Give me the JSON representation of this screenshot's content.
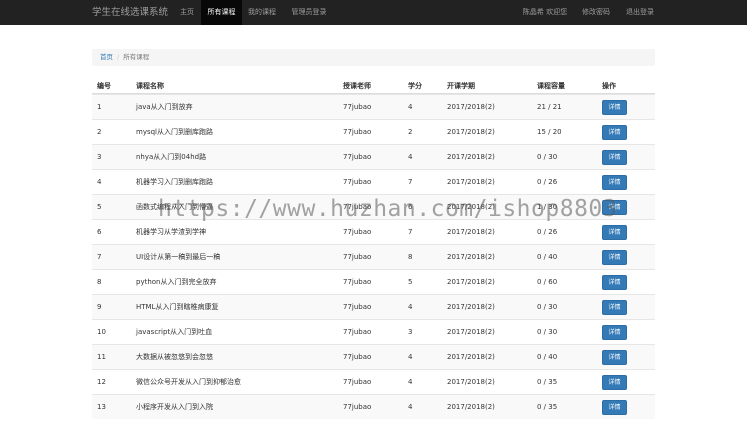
{
  "navbar": {
    "brand": "学生在线选课系统",
    "items": [
      "主页",
      "所有课程",
      "我的课程",
      "管理员登录"
    ],
    "right_items": [
      "陈晶希 欢迎您",
      "修改密码",
      "退出登录"
    ]
  },
  "breadcrumb": {
    "home": "首页",
    "separator": "/",
    "current": "所有课程"
  },
  "table": {
    "headers": [
      "编号",
      "课程名称",
      "授课老师",
      "学分",
      "开课学期",
      "课程容量",
      "操作"
    ],
    "action_label": "详情",
    "rows": [
      [
        "1",
        "java从入门到放弃",
        "77jubao",
        "4",
        "2017/2018(2)",
        "21 / 21"
      ],
      [
        "2",
        "mysql从入门到删库跑路",
        "77jubao",
        "2",
        "2017/2018(2)",
        "15 / 20"
      ],
      [
        "3",
        "nhya从入门到04hd路",
        "77jubao",
        "4",
        "2017/2018(2)",
        "0 / 30"
      ],
      [
        "4",
        "机器学习入门到删库跑路",
        "77jubao",
        "7",
        "2017/2018(2)",
        "0 / 26"
      ],
      [
        "5",
        "函数式编程从入门到懵逼",
        "77jubao",
        "6",
        "2017/2018(2)",
        "1 / 30"
      ],
      [
        "6",
        "机器学习从学渣到学神",
        "77jubao",
        "7",
        "2017/2018(2)",
        "0 / 26"
      ],
      [
        "7",
        "UI设计从第一稿到最后一稿",
        "77jubao",
        "8",
        "2017/2018(2)",
        "0 / 40"
      ],
      [
        "8",
        "python从入门到完全放弃",
        "77jubao",
        "5",
        "2017/2018(2)",
        "0 / 60"
      ],
      [
        "9",
        "HTML从入门到瞎椎病康复",
        "77jubao",
        "4",
        "2017/2018(2)",
        "0 / 30"
      ],
      [
        "10",
        "javascript从入门到吐血",
        "77jubao",
        "3",
        "2017/2018(2)",
        "0 / 30"
      ],
      [
        "11",
        "大数据从被忽悠到会忽悠",
        "77jubao",
        "4",
        "2017/2018(2)",
        "0 / 40"
      ],
      [
        "12",
        "微信公众号开发从入门到抑郁治愈",
        "77jubao",
        "4",
        "2017/2018(2)",
        "0 / 35"
      ],
      [
        "13",
        "小程序开发从入门到入院",
        "77jubao",
        "4",
        "2017/2018(2)",
        "0 / 35"
      ]
    ]
  },
  "watermark": "https://www.huzhan.com/ishop8803"
}
